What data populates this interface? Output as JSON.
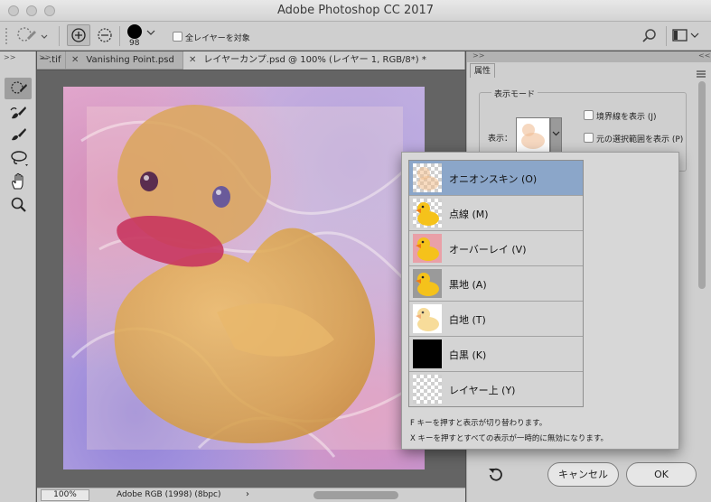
{
  "window": {
    "title": "Adobe Photoshop CC 2017"
  },
  "options_bar": {
    "brush_size": "98",
    "all_layers_label": "全レイヤーを対象"
  },
  "tabs": [
    {
      "label": "ー.tif"
    },
    {
      "label": "Vanishing Point.psd"
    },
    {
      "label": "レイヤーカンプ.psd @ 100% (レイヤー 1, RGB/8*) *"
    }
  ],
  "status": {
    "zoom": "100%",
    "profile": "Adobe RGB (1998) (8bpc)"
  },
  "panel": {
    "tab_label": "属性",
    "group_title": "表示モード",
    "display_label": "表示：",
    "show_edges_label": "境界線を表示 (J)",
    "show_original_label": "元の選択範囲を表示 (P)",
    "cancel_label": "キャンセル",
    "ok_label": "OK"
  },
  "view_mode_menu": {
    "items": [
      {
        "label": "オニオンスキン (O)",
        "selected": true
      },
      {
        "label": "点線 (M)",
        "selected": false
      },
      {
        "label": "オーバーレイ (V)",
        "selected": false
      },
      {
        "label": "黒地 (A)",
        "selected": false
      },
      {
        "label": "白地 (T)",
        "selected": false
      },
      {
        "label": "白黒 (K)",
        "selected": false
      },
      {
        "label": "レイヤー上 (Y)",
        "selected": false
      }
    ],
    "note1": "F キーを押すと表示が切り替わります。",
    "note2": "X キーを押すとすべての表示が一時的に無効になります。"
  },
  "colors": {
    "selected_row": "#8ba6c9",
    "duck_yellow": "#f5c21b",
    "beak_orange": "#f07a12"
  }
}
